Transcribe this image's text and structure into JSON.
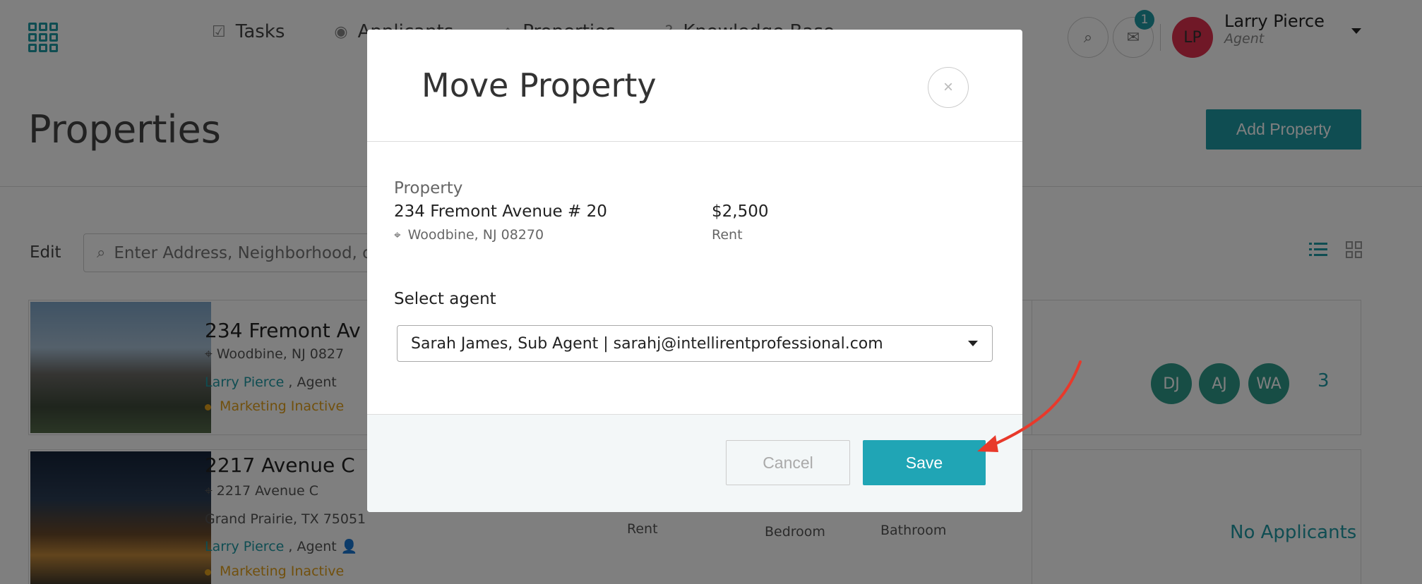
{
  "header": {
    "nav": [
      {
        "label": "Tasks",
        "icon": "check-circle-icon"
      },
      {
        "label": "Applicants",
        "icon": "user-circle-icon"
      },
      {
        "label": "Properties",
        "icon": "home-icon"
      },
      {
        "label": "Knowledge Base",
        "icon": "question-circle-icon"
      }
    ],
    "notification_count": "1",
    "user": {
      "initials": "LP",
      "name": "Larry Pierce",
      "role": "Agent"
    }
  },
  "page": {
    "title": "Properties",
    "add_button": "Add Property",
    "edit_label": "Edit",
    "search_placeholder": "Enter Address, Neighborhood, or"
  },
  "properties": [
    {
      "title": "234 Fremont Av",
      "location": "Woodbine, NJ 0827",
      "agent_name": "Larry Pierce",
      "agent_role": ", Agent",
      "status": "Marketing Inactive",
      "applicants": [
        "DJ",
        "AJ",
        "WA"
      ],
      "applicant_count": "3"
    },
    {
      "title": "2217 Avenue C",
      "address_line": "2217 Avenue C",
      "city_line": "Grand Prairie, TX 75051",
      "agent_name": "Larry Pierce",
      "agent_role": ", Agent",
      "status": "Marketing Inactive",
      "rent_label": "Rent",
      "bedroom_label": "Bedroom",
      "bathroom_label": "Bathroom",
      "no_applicants": "No Applicants"
    }
  ],
  "modal": {
    "title": "Move Property",
    "close": "×",
    "property_label": "Property",
    "property_address": "234 Fremont Avenue # 20",
    "property_location": "Woodbine, NJ 08270",
    "price": "$2,500",
    "price_label": "Rent",
    "agent_label": "Select agent",
    "agent_selected": "Sarah James, Sub Agent | sarahj@intellirentprofessional.com",
    "cancel": "Cancel",
    "save": "Save"
  },
  "colors": {
    "accent": "#1f9aa5",
    "save": "#20a5b5",
    "avatar": "#e0304f",
    "status": "#e3a01b",
    "arrow": "#e8392b"
  }
}
